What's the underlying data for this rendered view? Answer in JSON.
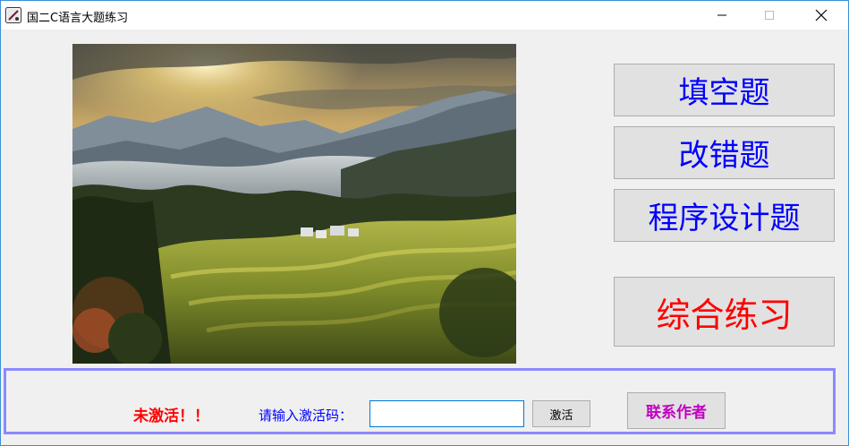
{
  "window": {
    "title": "国二C语言大题练习"
  },
  "buttons": {
    "fill_blank": "填空题",
    "fix_error": "改错题",
    "program_design": "程序设计题",
    "comprehensive": "综合练习"
  },
  "activation": {
    "status": "未激活！！",
    "code_label": "请输入激活码：",
    "code_value": "",
    "activate_label": "激活",
    "contact_label": "联系作者"
  },
  "colors": {
    "menu_text": "#0000ff",
    "comprehensive_text": "#ff0000",
    "status_text": "#ff0000",
    "contact_text": "#c000c0",
    "panel_border": "#8a8aff"
  },
  "icons": {
    "app": "app-icon",
    "minimize": "minimize-icon",
    "maximize": "maximize-icon",
    "close": "close-icon"
  },
  "image": {
    "subject": "mountain-landscape-photo"
  }
}
